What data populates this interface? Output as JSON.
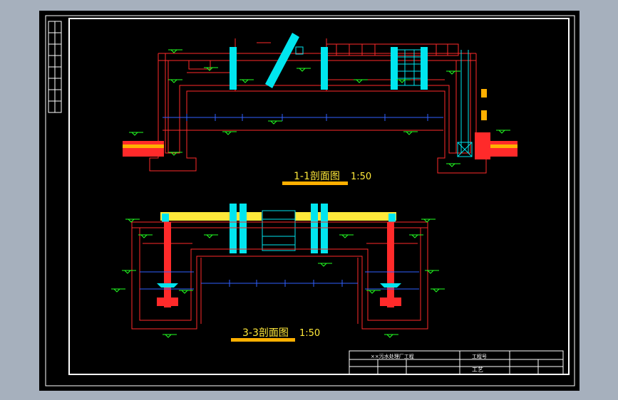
{
  "section_1": {
    "title": "1-1剖面图",
    "scale": "1:50"
  },
  "section_3": {
    "title": "3-3剖面图",
    "scale": "1:50"
  },
  "title_block": {
    "project": "××污水处理厂工程",
    "drawing": "工艺",
    "code": "工程号"
  },
  "colors": {
    "background": "#000000",
    "frame": "#ffffff",
    "structure": "#ff2a2a",
    "cyan": "#00e5ee",
    "yellow": "#ffe93a",
    "orange": "#ffb000",
    "green": "#22ff22",
    "blue": "#3060ff"
  }
}
